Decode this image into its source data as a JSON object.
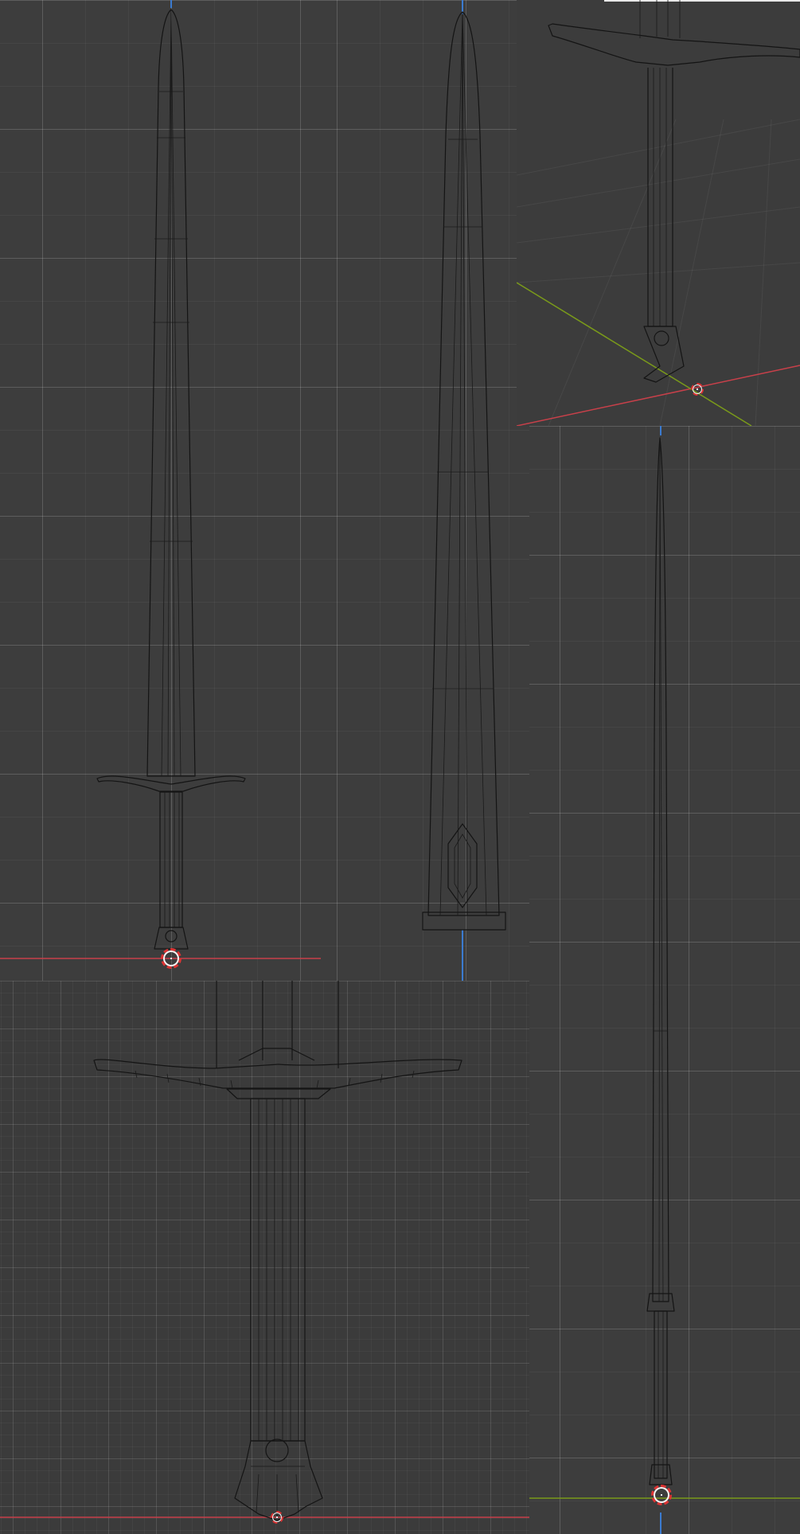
{
  "app": {
    "title": "",
    "viewports": [
      {
        "id": "front-ortho",
        "view": ""
      },
      {
        "id": "side-ortho",
        "view": ""
      },
      {
        "id": "perspective",
        "view": ""
      },
      {
        "id": "zoomed-hilt",
        "view": ""
      },
      {
        "id": "right-ortho",
        "view": ""
      }
    ]
  },
  "colors": {
    "background": "#3d3d3d",
    "grid_major": "#555555",
    "wire": "#141414",
    "x_axis": "#c8404a",
    "y_axis": "#7a9a1a",
    "z_axis": "#3b7bd0",
    "cursor_red": "#dd3333",
    "cursor_white": "#f5f5f5"
  },
  "icons": [
    "3d-cursor-icon"
  ]
}
